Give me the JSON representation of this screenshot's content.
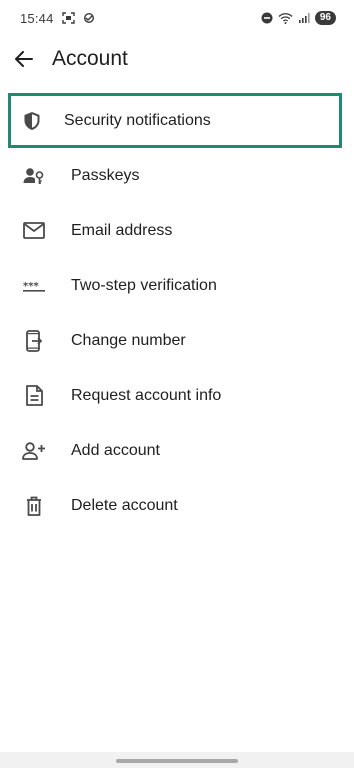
{
  "status_bar": {
    "time": "15:44",
    "battery": "96"
  },
  "app_bar": {
    "title": "Account"
  },
  "menu": {
    "items": [
      {
        "label": "Security notifications",
        "icon": "shield-icon",
        "highlighted": true
      },
      {
        "label": "Passkeys",
        "icon": "passkey-icon"
      },
      {
        "label": "Email address",
        "icon": "mail-icon"
      },
      {
        "label": "Two-step verification",
        "icon": "password-dots-icon"
      },
      {
        "label": "Change number",
        "icon": "change-number-icon"
      },
      {
        "label": "Request account info",
        "icon": "document-icon"
      },
      {
        "label": "Add account",
        "icon": "add-person-icon"
      },
      {
        "label": "Delete account",
        "icon": "trash-icon"
      }
    ]
  },
  "colors": {
    "highlight_border": "#1f8a70",
    "text": "#1f1f1f",
    "icon": "#4a4a4a"
  }
}
